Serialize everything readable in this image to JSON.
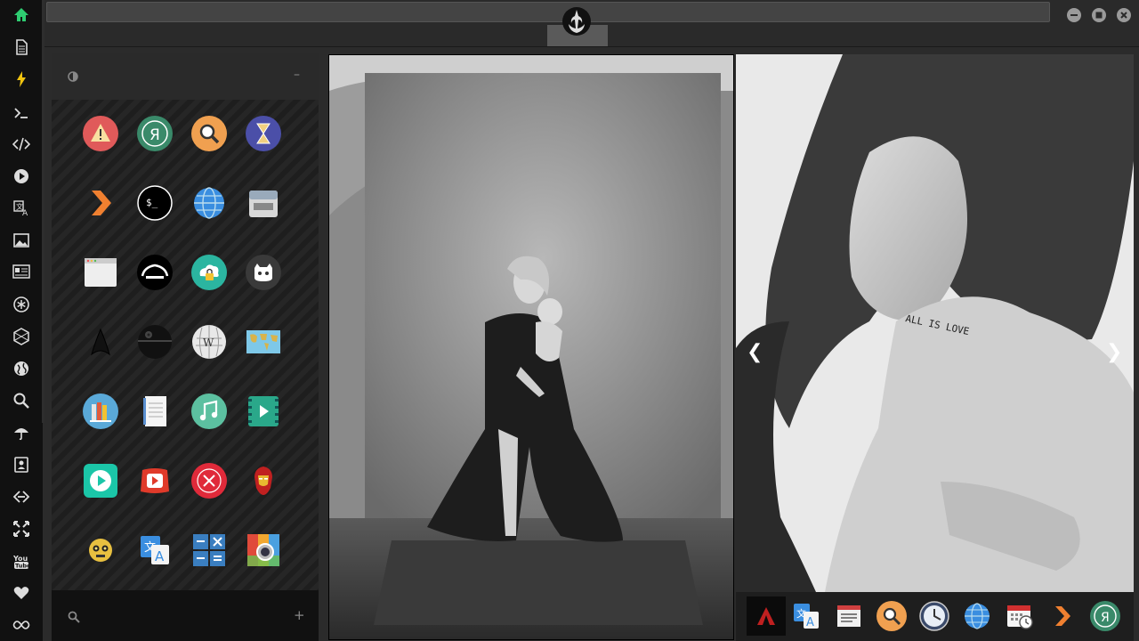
{
  "rail": {
    "items": [
      "home-icon",
      "document-icon",
      "bolt-icon",
      "terminal-icon",
      "code-icon",
      "play-icon",
      "translate-icon",
      "image-icon",
      "news-icon",
      "asterisk-icon",
      "hexagon-icon",
      "globe-icon",
      "search-icon",
      "umbrella-icon",
      "contacts-icon",
      "link-icon",
      "expand-icon",
      "youtube-icon",
      "heart-icon",
      "infinity-icon"
    ],
    "accent": "#2ecc71"
  },
  "panel": {
    "header_icon": "contrast-icon",
    "minimize_label": "–",
    "add_label": "+",
    "apps": [
      [
        "warning-icon",
        "yandex-icon",
        "search-icon",
        "hourglass-icon"
      ],
      [
        "plex-icon",
        "terminal-icon",
        "globe-icon",
        "archive-icon"
      ],
      [
        "window-icon",
        "arch-icon",
        "cloud-lock-icon",
        "github-icon"
      ],
      [
        "starfleet-icon",
        "deathstar-icon",
        "wikipedia-icon",
        "map-icon"
      ],
      [
        "books-icon",
        "notes-icon",
        "music-icon",
        "video-icon"
      ],
      [
        "play-button-icon",
        "youtube-red-icon",
        "close-circle-icon",
        "ironman-icon"
      ],
      [
        "c3po-icon",
        "translate-icon",
        "calculator-icon",
        "photos-icon"
      ]
    ]
  },
  "photos": {
    "caption_tattoo": "ALL IS LOVE",
    "prev_label": "❮",
    "next_label": "❯"
  },
  "dock": {
    "items": [
      "arch-app-icon",
      "translate-app-icon",
      "calendar-news-icon",
      "search-app-icon",
      "clock-app-icon",
      "globe-app-icon",
      "calendar-app-icon",
      "plex-app-icon",
      "yandex-app-icon"
    ]
  },
  "colors": {
    "rail_bg": "#111111",
    "panel_bg": "#1c1c1c",
    "topbar_bg": "#2a2a2a"
  }
}
